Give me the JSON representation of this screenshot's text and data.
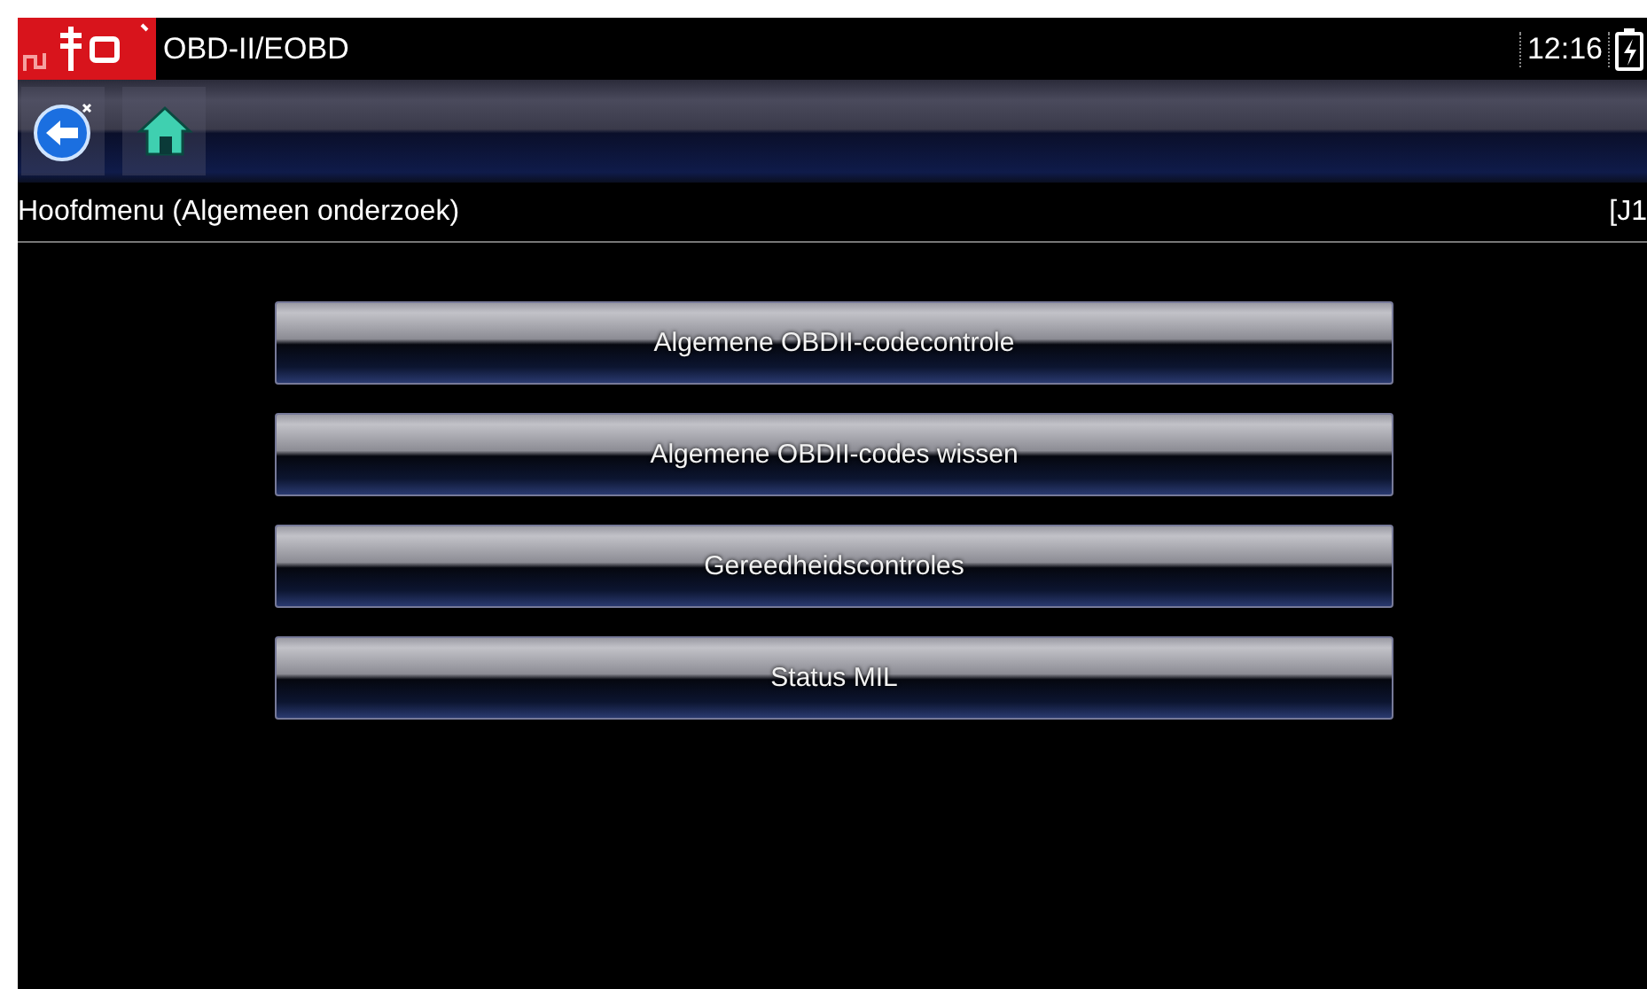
{
  "title_bar": {
    "title": "OBD-II/EOBD",
    "time": "12:16"
  },
  "toolbar": {
    "buttons": [
      {
        "kind": "back"
      },
      {
        "kind": "home"
      }
    ]
  },
  "header": {
    "title": "Hoofdmenu (Algemeen onderzoek)",
    "code": "[J1"
  },
  "menu": [
    {
      "label": "Algemene OBDII-codecontrole"
    },
    {
      "label": "Algemene OBDII-codes wissen"
    },
    {
      "label": "Gereedheidscontroles"
    },
    {
      "label": "Status MIL"
    }
  ]
}
